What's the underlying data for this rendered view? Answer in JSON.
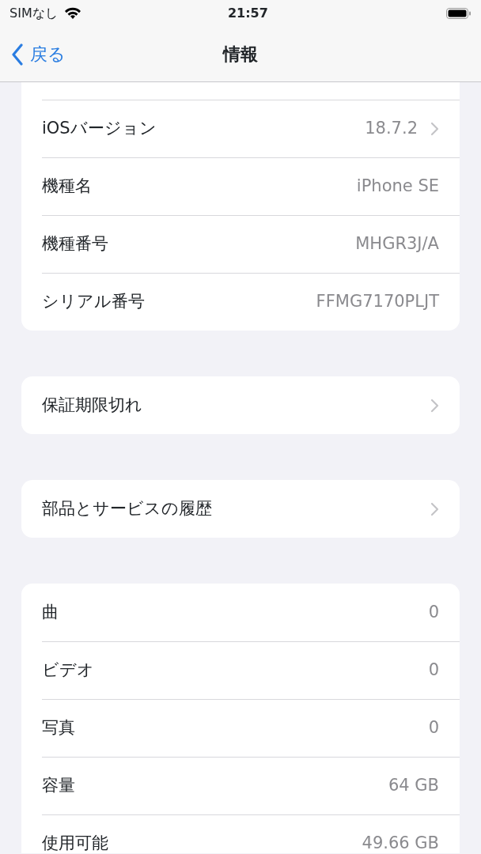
{
  "status_bar": {
    "carrier": "SIMなし",
    "time": "21:57"
  },
  "nav": {
    "back_label": "戻る",
    "title": "情報"
  },
  "sections": [
    {
      "rows": [
        {
          "label": "iOSバージョン",
          "value": "18.7.2",
          "disclosure": true
        },
        {
          "label": "機種名",
          "value": "iPhone SE",
          "disclosure": false
        },
        {
          "label": "機種番号",
          "value": "MHGR3J/A",
          "disclosure": false
        },
        {
          "label": "シリアル番号",
          "value": "FFMG7170PLJT",
          "disclosure": false
        }
      ]
    },
    {
      "rows": [
        {
          "label": "保証期限切れ",
          "disclosure": true
        }
      ]
    },
    {
      "rows": [
        {
          "label": "部品とサービスの履歴",
          "disclosure": true
        }
      ]
    },
    {
      "rows": [
        {
          "label": "曲",
          "value": "0",
          "disclosure": false
        },
        {
          "label": "ビデオ",
          "value": "0",
          "disclosure": false
        },
        {
          "label": "写真",
          "value": "0",
          "disclosure": false
        },
        {
          "label": "容量",
          "value": "64 GB",
          "disclosure": false
        },
        {
          "label": "使用可能",
          "value": "49.66 GB",
          "disclosure": false
        }
      ]
    }
  ]
}
